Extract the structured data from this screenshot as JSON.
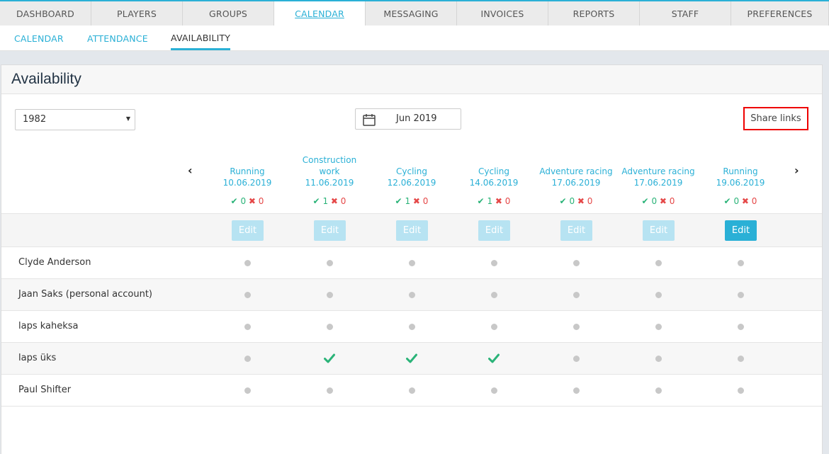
{
  "top_nav": [
    {
      "label": "DASHBOARD",
      "active": false
    },
    {
      "label": "PLAYERS",
      "active": false
    },
    {
      "label": "GROUPS",
      "active": false
    },
    {
      "label": "CALENDAR",
      "active": true
    },
    {
      "label": "MESSAGING",
      "active": false
    },
    {
      "label": "INVOICES",
      "active": false
    },
    {
      "label": "REPORTS",
      "active": false
    },
    {
      "label": "STAFF",
      "active": false
    },
    {
      "label": "PREFERENCES",
      "active": false
    }
  ],
  "sub_nav": [
    {
      "label": "CALENDAR",
      "active": false
    },
    {
      "label": "ATTENDANCE",
      "active": false
    },
    {
      "label": "AVAILABILITY",
      "active": true
    }
  ],
  "page_title": "Availability",
  "filter": {
    "selected": "1982"
  },
  "date_picker": {
    "value": "Jun 2019"
  },
  "share_button": "Share links",
  "events": [
    {
      "title_lines": [
        "Running"
      ],
      "date": "10.06.2019",
      "yes": "0",
      "no": "0",
      "edit_label": "Edit",
      "editable": false
    },
    {
      "title_lines": [
        "Construction",
        "work"
      ],
      "date": "11.06.2019",
      "yes": "1",
      "no": "0",
      "edit_label": "Edit",
      "editable": false
    },
    {
      "title_lines": [
        "Cycling"
      ],
      "date": "12.06.2019",
      "yes": "1",
      "no": "0",
      "edit_label": "Edit",
      "editable": false
    },
    {
      "title_lines": [
        "Cycling"
      ],
      "date": "14.06.2019",
      "yes": "1",
      "no": "0",
      "edit_label": "Edit",
      "editable": false
    },
    {
      "title_lines": [
        "Adventure racing"
      ],
      "date": "17.06.2019",
      "yes": "0",
      "no": "0",
      "edit_label": "Edit",
      "editable": false
    },
    {
      "title_lines": [
        "Adventure racing"
      ],
      "date": "17.06.2019",
      "yes": "0",
      "no": "0",
      "edit_label": "Edit",
      "editable": false
    },
    {
      "title_lines": [
        "Running"
      ],
      "date": "19.06.2019",
      "yes": "0",
      "no": "0",
      "edit_label": "Edit",
      "editable": true
    }
  ],
  "players": [
    {
      "name": "Clyde Anderson",
      "availability": [
        "none",
        "none",
        "none",
        "none",
        "none",
        "none",
        "none"
      ]
    },
    {
      "name": "Jaan Saks (personal account)",
      "availability": [
        "none",
        "none",
        "none",
        "none",
        "none",
        "none",
        "none"
      ]
    },
    {
      "name": "laps kaheksa",
      "availability": [
        "none",
        "none",
        "none",
        "none",
        "none",
        "none",
        "none"
      ]
    },
    {
      "name": "laps üks",
      "availability": [
        "none",
        "yes",
        "yes",
        "yes",
        "none",
        "none",
        "none"
      ]
    },
    {
      "name": "Paul Shifter",
      "availability": [
        "none",
        "none",
        "none",
        "none",
        "none",
        "none",
        "none"
      ]
    }
  ],
  "icons": {
    "prev": "chevron-left-icon",
    "next": "chevron-right-icon",
    "calendar": "calendar-icon",
    "yes": "check-icon",
    "no": "cross-icon",
    "unknown": "dot-icon"
  },
  "colors": {
    "accent": "#2ab0d6",
    "yes": "#2ab378",
    "no": "#e54848",
    "highlight": "#e00000"
  }
}
